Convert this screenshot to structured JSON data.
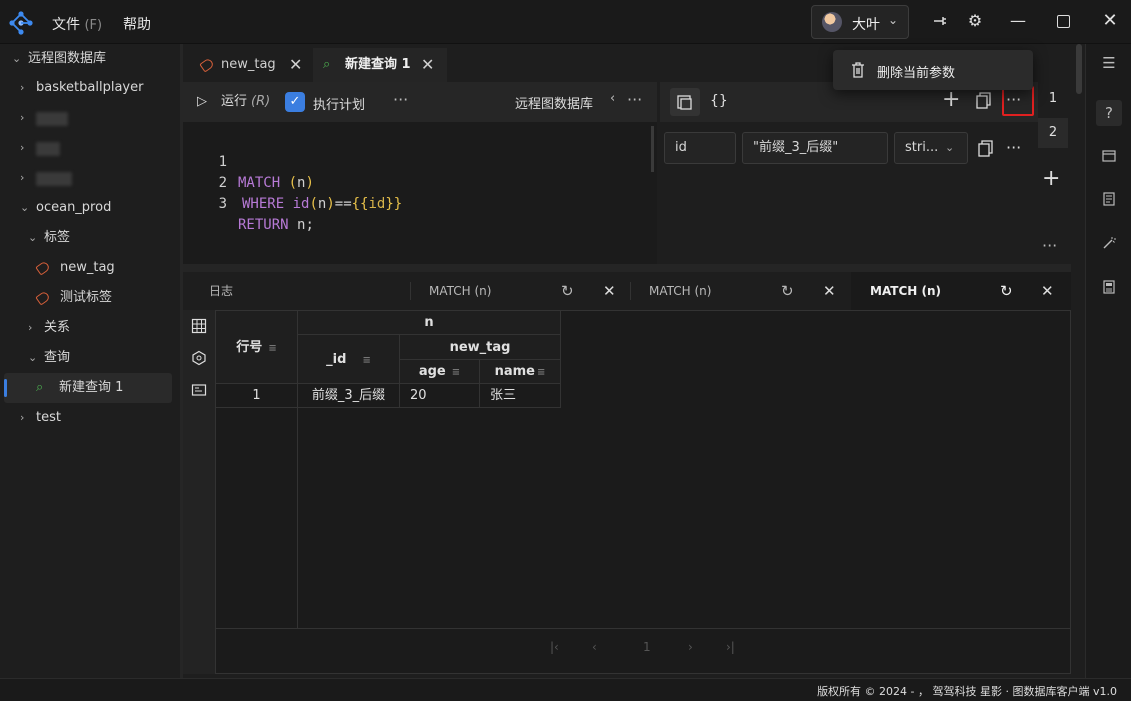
{
  "titlebar": {
    "menu_file": "文件",
    "menu_file_mnemonic": "(F)",
    "menu_help": "帮助",
    "user_name": "大叶"
  },
  "sidebar": {
    "root": "远程图数据库",
    "items": [
      {
        "label": "basketballplayer"
      },
      {
        "label": "ocean_prod"
      },
      {
        "label": "标签"
      },
      {
        "label": "new_tag"
      },
      {
        "label": "测试标签"
      },
      {
        "label": "关系"
      },
      {
        "label": "查询"
      },
      {
        "label": "新建查询 1"
      },
      {
        "label": "test"
      }
    ]
  },
  "tabs": [
    {
      "label": "new_tag"
    },
    {
      "label": "新建查询 1"
    }
  ],
  "editor_toolbar": {
    "run": "运行",
    "run_shortcut": "(R)",
    "exec_plan": "执行计划",
    "db_name": "远程图数据库"
  },
  "editor": {
    "lines": [
      {
        "num": "1"
      },
      {
        "num": "2"
      },
      {
        "num": "3"
      }
    ],
    "kw_match": "MATCH",
    "kw_where": "WHERE",
    "kw_return": "RETURN",
    "fn_id": "id"
  },
  "params": {
    "braces": "{}",
    "name": "id",
    "value": "\"前缀_3_后缀\"",
    "type": "stri...",
    "set_numbers": [
      "1",
      "2"
    ]
  },
  "context_menu": {
    "delete_param": "删除当前参数"
  },
  "result_tabs": [
    {
      "label": "日志"
    },
    {
      "label": "MATCH (n)"
    },
    {
      "label": "MATCH (n)"
    },
    {
      "label": "MATCH (n)"
    }
  ],
  "table": {
    "row_header": "行号",
    "group_n": "n",
    "col_id": "_id",
    "group_new_tag": "new_tag",
    "col_age": "age",
    "col_name": "name",
    "rows": [
      {
        "row": "1",
        "id": "前缀_3_后缀",
        "age": "20",
        "name": "张三"
      }
    ],
    "page": "1"
  },
  "footer": {
    "text": "版权所有 © 2024 - ， 驾驾科技  星影 · 图数据库客户端  v1.0"
  }
}
